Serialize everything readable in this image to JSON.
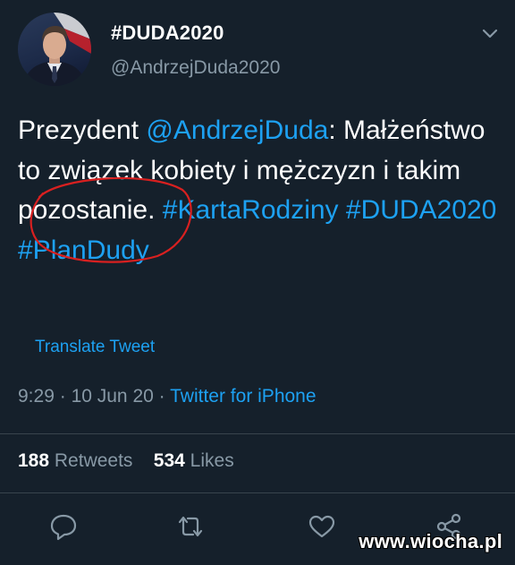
{
  "tweet": {
    "display_name": "#DUDA2020",
    "handle": "@AndrzejDuda2020",
    "text": {
      "part1": "Prezydent ",
      "mention": "@AndrzejDuda",
      "part2": ": Małżeństwo to związek kobiety i mężczyzn i takim pozostanie. ",
      "hashtag1": "#KartaRodziny",
      "hashtag2": "#DUDA2020",
      "hashtag3": "#PlanDudy"
    },
    "translate_label": "Translate Tweet",
    "time": "9:29",
    "date": "10 Jun 20",
    "separator": "·",
    "source": "Twitter for iPhone",
    "retweets_count": "188",
    "retweets_label": "Retweets",
    "likes_count": "534",
    "likes_label": "Likes"
  },
  "icons": {
    "caret": "chevron-down-icon",
    "reply": "reply-icon",
    "retweet": "retweet-icon",
    "like": "heart-icon",
    "share": "share-icon"
  },
  "watermark": "www.wiocha.pl",
  "colors": {
    "background": "#15202b",
    "accent": "#1da1f2",
    "secondary_text": "#8899a6",
    "annotation": "#d92020"
  }
}
